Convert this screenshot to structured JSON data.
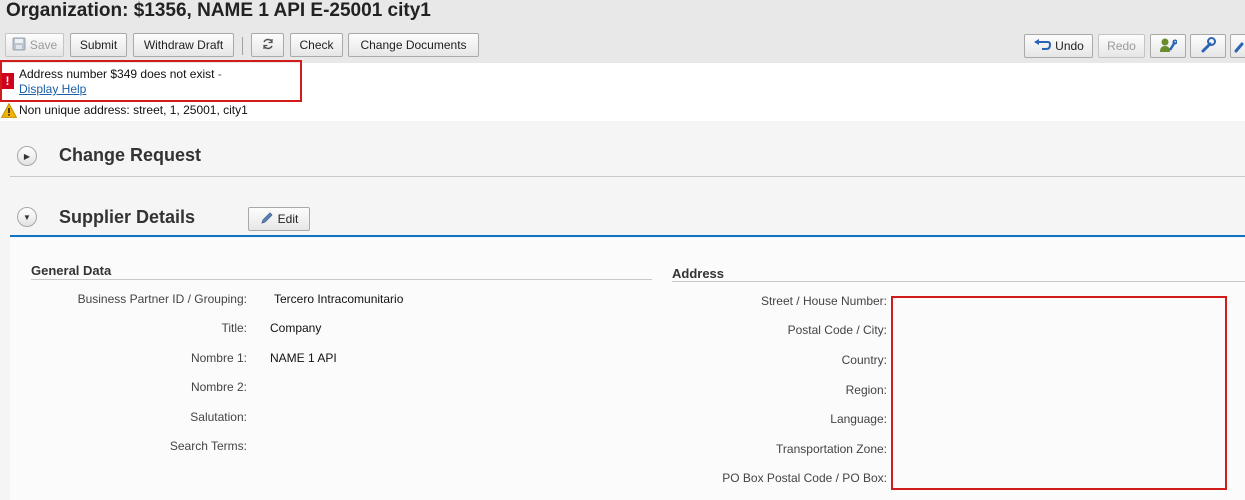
{
  "title": "Organization: $1356, NAME 1 API E-25001 city1",
  "toolbar": {
    "save": "Save",
    "submit": "Submit",
    "withdraw_draft": "Withdraw Draft",
    "check": "Check",
    "change_documents": "Change Documents",
    "undo": "Undo",
    "redo": "Redo"
  },
  "messages": {
    "error_text": "Address number $349 does not exist",
    "error_dash": "-",
    "error_link": "Display Help",
    "warning_text": "Non unique address: street, 1, 25001, city1"
  },
  "sections": {
    "change_request": "Change Request",
    "supplier_details": "Supplier Details",
    "edit": "Edit"
  },
  "general_data": {
    "title": "General Data",
    "fields": [
      {
        "label": "Business Partner ID / Grouping:",
        "value": "Tercero Intracomunitario"
      },
      {
        "label": "Title:",
        "value": "Company"
      },
      {
        "label": "Nombre 1:",
        "value": "NAME 1 API"
      },
      {
        "label": "Nombre 2:",
        "value": ""
      },
      {
        "label": "Salutation:",
        "value": ""
      },
      {
        "label": "Search Terms:",
        "value": ""
      }
    ]
  },
  "address": {
    "title": "Address",
    "fields": [
      {
        "label": "Street / House Number:"
      },
      {
        "label": "Postal Code / City:"
      },
      {
        "label": "Country:"
      },
      {
        "label": "Region:"
      },
      {
        "label": "Language:"
      },
      {
        "label": "Transportation Zone:"
      },
      {
        "label": "PO Box Postal Code / PO Box:"
      }
    ]
  },
  "colors": {
    "error": "#d0021b",
    "warning": "#f0b400",
    "highlight_box": "#d11a1a",
    "accent_line": "#0f74c4"
  }
}
